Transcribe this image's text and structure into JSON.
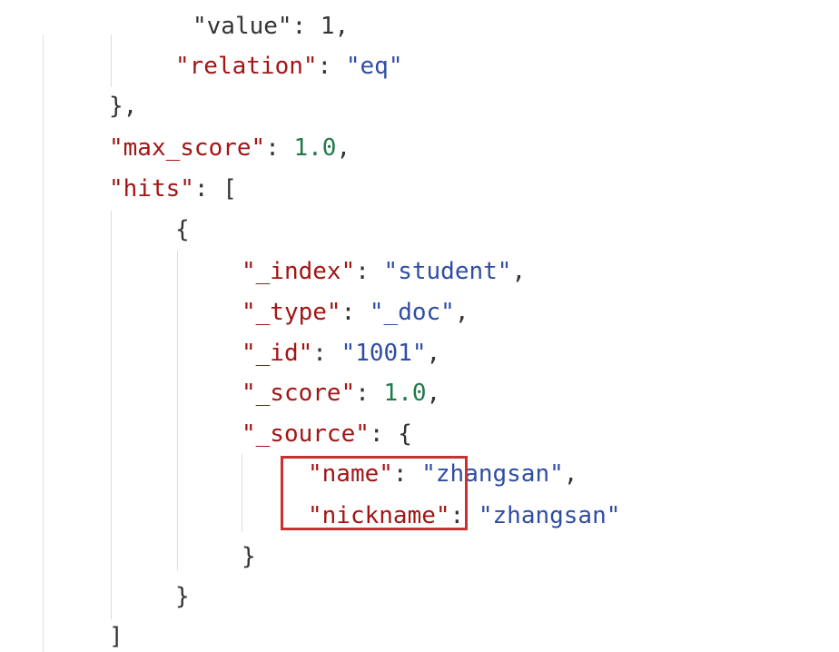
{
  "editor": {
    "highlight_color": "#c8312f",
    "syntax_colors": {
      "key": "#a31515",
      "string": "#2f4da3",
      "number": "#1f7a4a",
      "punctuation": "#333333"
    },
    "lines": [
      {
        "tokens": [
          {
            "t": "\"value\": 1,",
            "c": "punc"
          }
        ]
      },
      {
        "tokens": [
          {
            "t": "\"relation\"",
            "c": "key"
          },
          {
            "t": ": ",
            "c": "punc"
          },
          {
            "t": "\"eq\"",
            "c": "str"
          }
        ]
      },
      {
        "tokens": [
          {
            "t": "},",
            "c": "punc"
          }
        ]
      },
      {
        "tokens": [
          {
            "t": "\"max_score\"",
            "c": "key"
          },
          {
            "t": ": ",
            "c": "punc"
          },
          {
            "t": "1.0",
            "c": "num"
          },
          {
            "t": ",",
            "c": "punc"
          }
        ]
      },
      {
        "tokens": [
          {
            "t": "\"hits\"",
            "c": "key"
          },
          {
            "t": ": [",
            "c": "punc"
          }
        ]
      },
      {
        "tokens": [
          {
            "t": "{",
            "c": "punc"
          }
        ]
      },
      {
        "tokens": [
          {
            "t": "\"_index\"",
            "c": "key"
          },
          {
            "t": ": ",
            "c": "punc"
          },
          {
            "t": "\"student\"",
            "c": "str"
          },
          {
            "t": ",",
            "c": "punc"
          }
        ]
      },
      {
        "tokens": [
          {
            "t": "\"_type\"",
            "c": "key"
          },
          {
            "t": ": ",
            "c": "punc"
          },
          {
            "t": "\"_doc\"",
            "c": "str"
          },
          {
            "t": ",",
            "c": "punc"
          }
        ]
      },
      {
        "tokens": [
          {
            "t": "\"_id\"",
            "c": "key"
          },
          {
            "t": ": ",
            "c": "punc"
          },
          {
            "t": "\"1001\"",
            "c": "str"
          },
          {
            "t": ",",
            "c": "punc"
          }
        ]
      },
      {
        "tokens": [
          {
            "t": "\"_score\"",
            "c": "key"
          },
          {
            "t": ": ",
            "c": "punc"
          },
          {
            "t": "1.0",
            "c": "num"
          },
          {
            "t": ",",
            "c": "punc"
          }
        ]
      },
      {
        "tokens": [
          {
            "t": "\"_source\"",
            "c": "key"
          },
          {
            "t": ": {",
            "c": "punc"
          }
        ]
      },
      {
        "tokens": [
          {
            "t": "\"name\"",
            "c": "key"
          },
          {
            "t": ": ",
            "c": "punc"
          },
          {
            "t": "\"zhangsan\"",
            "c": "str"
          },
          {
            "t": ",",
            "c": "punc"
          }
        ]
      },
      {
        "tokens": [
          {
            "t": "\"nickname\"",
            "c": "key"
          },
          {
            "t": ": ",
            "c": "punc"
          },
          {
            "t": "\"zhangsan\"",
            "c": "str"
          }
        ]
      },
      {
        "tokens": [
          {
            "t": "}",
            "c": "punc"
          }
        ]
      },
      {
        "tokens": [
          {
            "t": "}",
            "c": "punc"
          }
        ]
      },
      {
        "tokens": [
          {
            "t": "]",
            "c": "punc"
          }
        ]
      }
    ]
  }
}
